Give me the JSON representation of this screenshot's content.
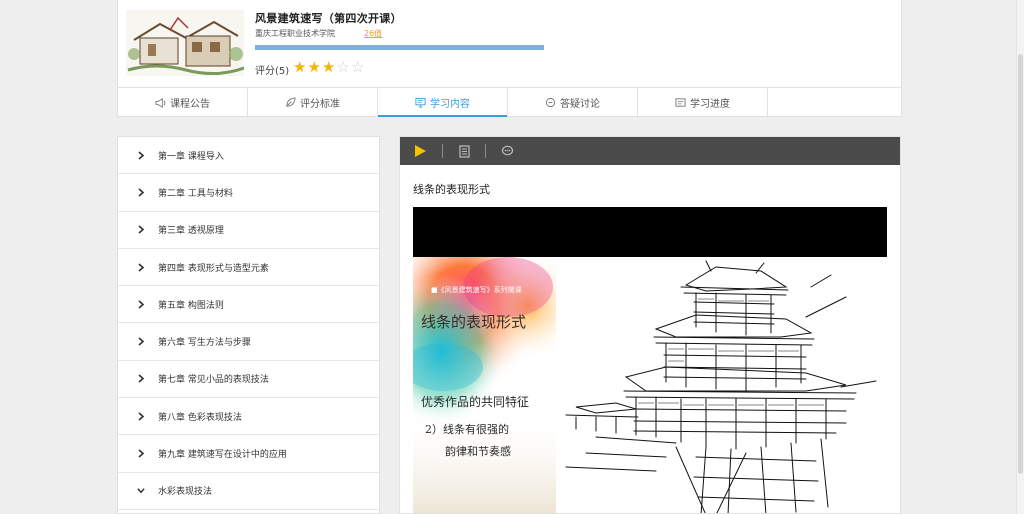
{
  "course": {
    "title": "风景建筑速写（第四次开课）",
    "school": "重庆工程职业技术学院",
    "count": "26值",
    "progress": 1.0,
    "rating_label": "评分(5)",
    "stars_on": 3,
    "stars_total": 5
  },
  "tabs": [
    {
      "label": "课程公告",
      "icon": "megaphone-icon"
    },
    {
      "label": "评分标准",
      "icon": "leaf-icon"
    },
    {
      "label": "学习内容",
      "icon": "monitor-icon",
      "active": true
    },
    {
      "label": "答疑讨论",
      "icon": "chat-icon"
    },
    {
      "label": "学习进度",
      "icon": "progress-icon"
    }
  ],
  "chapters": [
    {
      "label": "第一章 课程导入",
      "expanded": false
    },
    {
      "label": "第二章 工具与材料",
      "expanded": false
    },
    {
      "label": "第三章 透视原理",
      "expanded": false
    },
    {
      "label": "第四章 表现形式与造型元素",
      "expanded": false
    },
    {
      "label": "第五章 构图法则",
      "expanded": false
    },
    {
      "label": "第六章 写生方法与步骤",
      "expanded": false
    },
    {
      "label": "第七章 常见小品的表现技法",
      "expanded": false
    },
    {
      "label": "第八章 色彩表现技法",
      "expanded": false
    },
    {
      "label": "第九章 建筑速写在设计中的应用",
      "expanded": false
    },
    {
      "label": "水彩表现技法",
      "expanded": true
    }
  ],
  "toolbar": {
    "items": [
      "play-icon",
      "document-icon",
      "discussion-icon"
    ],
    "accent": "#f5c300"
  },
  "lesson": {
    "title": "线条的表现形式",
    "slide": {
      "series": "■《风景建筑速写》系列微课",
      "heading": "线条的表现形式",
      "subheading": "优秀作品的共同特征",
      "point_line1": "2）线条有很强的",
      "point_line2": "韵律和节奏感"
    }
  },
  "colors": {
    "accent_blue": "#3a9fd8",
    "star": "#f4b400",
    "count_orange": "#f39b1b"
  }
}
